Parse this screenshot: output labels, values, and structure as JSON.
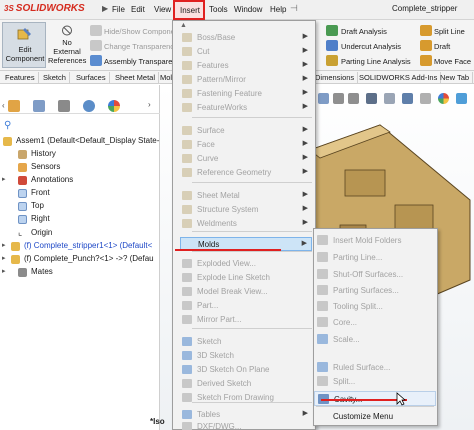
{
  "app": {
    "logo": "SOLIDWORKS",
    "logo_prefix": "3S",
    "document_title": "Complete_stripper"
  },
  "menubar": {
    "items": [
      "File",
      "Edit",
      "View",
      "Insert",
      "Tools",
      "Window",
      "Help"
    ],
    "active": "Insert"
  },
  "command_manager": {
    "edit_component": [
      "Edit",
      "Component"
    ],
    "no_external_refs": [
      "No",
      "External",
      "References"
    ],
    "small_commands": [
      "Hide/Show Components",
      "Change Transparency",
      "Assembly Transparency"
    ],
    "right_commands": [
      "Draft Analysis",
      "Undercut Analysis",
      "Parting Line Analysis"
    ],
    "far_right_commands": [
      "Split Line",
      "Draft",
      "Move Face"
    ]
  },
  "tabs": [
    "Features",
    "Sketch",
    "Surfaces",
    "Sheet Metal",
    "Mol",
    "Dimensions",
    "SOLIDWORKS Add-Ins",
    "New Tab"
  ],
  "feature_tree": {
    "filter_icon": "filter-icon",
    "root": "Assem1  (Default<Default_Display State-",
    "items": [
      {
        "label": "History",
        "icon": "history-icon",
        "indent": 1
      },
      {
        "label": "Sensors",
        "icon": "sensor-icon",
        "indent": 1
      },
      {
        "label": "Annotations",
        "icon": "annotation-icon",
        "indent": 1
      },
      {
        "label": "Front",
        "icon": "plane-icon",
        "indent": 1
      },
      {
        "label": "Top",
        "icon": "plane-icon",
        "indent": 1
      },
      {
        "label": "Right",
        "icon": "plane-icon",
        "indent": 1
      },
      {
        "label": "Origin",
        "icon": "origin-icon",
        "indent": 1
      },
      {
        "label": "(f) Complete_stripper1<1> (Default<",
        "icon": "part-icon",
        "indent": 1
      },
      {
        "label": "(f) Complete_Punch?<1> ->? (Defau",
        "icon": "part-icon",
        "indent": 1
      },
      {
        "label": "Mates",
        "icon": "mates-icon",
        "indent": 1
      }
    ]
  },
  "insert_menu": {
    "groups": [
      {
        "label": "Boss/Base",
        "enabled": false,
        "arrow": true
      },
      {
        "label": "Cut",
        "enabled": false,
        "arrow": true
      },
      {
        "label": "Features",
        "enabled": false,
        "arrow": true
      },
      {
        "label": "Pattern/Mirror",
        "enabled": false,
        "arrow": true
      },
      {
        "label": "Fastening Feature",
        "enabled": false,
        "arrow": true
      },
      {
        "label": "FeatureWorks",
        "enabled": false,
        "arrow": true
      },
      {
        "label": "Surface",
        "enabled": false,
        "arrow": true
      },
      {
        "label": "Face",
        "enabled": false,
        "arrow": true
      },
      {
        "label": "Curve",
        "enabled": false,
        "arrow": true
      },
      {
        "label": "Reference Geometry",
        "enabled": false,
        "arrow": true
      },
      {
        "label": "Sheet Metal",
        "enabled": false,
        "arrow": true
      },
      {
        "label": "Structure System",
        "enabled": false,
        "arrow": true
      },
      {
        "label": "Weldments",
        "enabled": false,
        "arrow": true
      },
      {
        "label": "Molds",
        "enabled": true,
        "arrow": true
      },
      {
        "label": "Exploded View...",
        "enabled": false,
        "arrow": false
      },
      {
        "label": "Explode Line Sketch",
        "enabled": false,
        "arrow": false
      },
      {
        "label": "Model Break View...",
        "enabled": false,
        "arrow": false
      },
      {
        "label": "Part...",
        "enabled": false,
        "arrow": false
      },
      {
        "label": "Mirror Part...",
        "enabled": false,
        "arrow": false
      },
      {
        "label": "Sketch",
        "enabled": false,
        "arrow": false
      },
      {
        "label": "3D Sketch",
        "enabled": false,
        "arrow": false
      },
      {
        "label": "3D Sketch On Plane",
        "enabled": false,
        "arrow": false
      },
      {
        "label": "Derived Sketch",
        "enabled": false,
        "arrow": false
      },
      {
        "label": "Sketch From Drawing",
        "enabled": false,
        "arrow": false
      },
      {
        "label": "Tables",
        "enabled": false,
        "arrow": true
      },
      {
        "label": "DXF/DWG...",
        "enabled": false,
        "arrow": false
      }
    ]
  },
  "molds_submenu": {
    "items": [
      {
        "label": "Insert Mold Folders",
        "enabled": false
      },
      {
        "label": "Parting Line...",
        "enabled": false
      },
      {
        "label": "Shut-Off Surfaces...",
        "enabled": false
      },
      {
        "label": "Parting Surfaces...",
        "enabled": false
      },
      {
        "label": "Tooling Split...",
        "enabled": false
      },
      {
        "label": "Core...",
        "enabled": false
      },
      {
        "label": "Scale...",
        "enabled": false
      },
      {
        "label": "Ruled Surface...",
        "enabled": false
      },
      {
        "label": "Ruled Surface...",
        "enabled": false
      },
      {
        "label": "Split...",
        "enabled": false
      },
      {
        "label": "Cavity...",
        "enabled": true
      },
      {
        "label": "Customize Menu",
        "enabled": true
      }
    ]
  },
  "viewport": {
    "view_label": "*Iso"
  },
  "colors": {
    "accent_red": "#e02020",
    "highlight_blue": "#cde4f7",
    "part_tan": "#c9a866",
    "part_dark": "#8a6d3a"
  }
}
